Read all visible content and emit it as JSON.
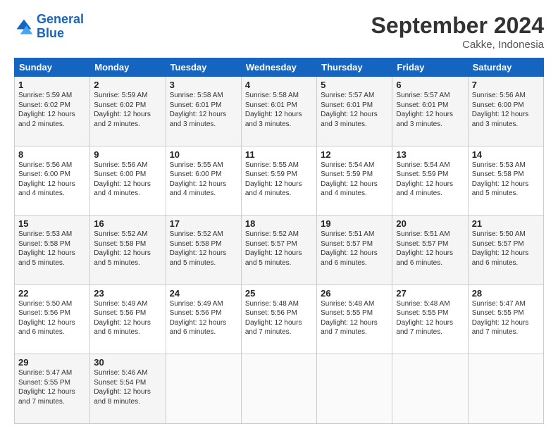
{
  "logo": {
    "line1": "General",
    "line2": "Blue"
  },
  "header": {
    "month": "September 2024",
    "location": "Cakke, Indonesia"
  },
  "weekdays": [
    "Sunday",
    "Monday",
    "Tuesday",
    "Wednesday",
    "Thursday",
    "Friday",
    "Saturday"
  ],
  "weeks": [
    [
      {
        "day": "1",
        "info": "Sunrise: 5:59 AM\nSunset: 6:02 PM\nDaylight: 12 hours\nand 2 minutes."
      },
      {
        "day": "2",
        "info": "Sunrise: 5:59 AM\nSunset: 6:02 PM\nDaylight: 12 hours\nand 2 minutes."
      },
      {
        "day": "3",
        "info": "Sunrise: 5:58 AM\nSunset: 6:01 PM\nDaylight: 12 hours\nand 3 minutes."
      },
      {
        "day": "4",
        "info": "Sunrise: 5:58 AM\nSunset: 6:01 PM\nDaylight: 12 hours\nand 3 minutes."
      },
      {
        "day": "5",
        "info": "Sunrise: 5:57 AM\nSunset: 6:01 PM\nDaylight: 12 hours\nand 3 minutes."
      },
      {
        "day": "6",
        "info": "Sunrise: 5:57 AM\nSunset: 6:01 PM\nDaylight: 12 hours\nand 3 minutes."
      },
      {
        "day": "7",
        "info": "Sunrise: 5:56 AM\nSunset: 6:00 PM\nDaylight: 12 hours\nand 3 minutes."
      }
    ],
    [
      {
        "day": "8",
        "info": "Sunrise: 5:56 AM\nSunset: 6:00 PM\nDaylight: 12 hours\nand 4 minutes."
      },
      {
        "day": "9",
        "info": "Sunrise: 5:56 AM\nSunset: 6:00 PM\nDaylight: 12 hours\nand 4 minutes."
      },
      {
        "day": "10",
        "info": "Sunrise: 5:55 AM\nSunset: 6:00 PM\nDaylight: 12 hours\nand 4 minutes."
      },
      {
        "day": "11",
        "info": "Sunrise: 5:55 AM\nSunset: 5:59 PM\nDaylight: 12 hours\nand 4 minutes."
      },
      {
        "day": "12",
        "info": "Sunrise: 5:54 AM\nSunset: 5:59 PM\nDaylight: 12 hours\nand 4 minutes."
      },
      {
        "day": "13",
        "info": "Sunrise: 5:54 AM\nSunset: 5:59 PM\nDaylight: 12 hours\nand 4 minutes."
      },
      {
        "day": "14",
        "info": "Sunrise: 5:53 AM\nSunset: 5:58 PM\nDaylight: 12 hours\nand 5 minutes."
      }
    ],
    [
      {
        "day": "15",
        "info": "Sunrise: 5:53 AM\nSunset: 5:58 PM\nDaylight: 12 hours\nand 5 minutes."
      },
      {
        "day": "16",
        "info": "Sunrise: 5:52 AM\nSunset: 5:58 PM\nDaylight: 12 hours\nand 5 minutes."
      },
      {
        "day": "17",
        "info": "Sunrise: 5:52 AM\nSunset: 5:58 PM\nDaylight: 12 hours\nand 5 minutes."
      },
      {
        "day": "18",
        "info": "Sunrise: 5:52 AM\nSunset: 5:57 PM\nDaylight: 12 hours\nand 5 minutes."
      },
      {
        "day": "19",
        "info": "Sunrise: 5:51 AM\nSunset: 5:57 PM\nDaylight: 12 hours\nand 6 minutes."
      },
      {
        "day": "20",
        "info": "Sunrise: 5:51 AM\nSunset: 5:57 PM\nDaylight: 12 hours\nand 6 minutes."
      },
      {
        "day": "21",
        "info": "Sunrise: 5:50 AM\nSunset: 5:57 PM\nDaylight: 12 hours\nand 6 minutes."
      }
    ],
    [
      {
        "day": "22",
        "info": "Sunrise: 5:50 AM\nSunset: 5:56 PM\nDaylight: 12 hours\nand 6 minutes."
      },
      {
        "day": "23",
        "info": "Sunrise: 5:49 AM\nSunset: 5:56 PM\nDaylight: 12 hours\nand 6 minutes."
      },
      {
        "day": "24",
        "info": "Sunrise: 5:49 AM\nSunset: 5:56 PM\nDaylight: 12 hours\nand 6 minutes."
      },
      {
        "day": "25",
        "info": "Sunrise: 5:48 AM\nSunset: 5:56 PM\nDaylight: 12 hours\nand 7 minutes."
      },
      {
        "day": "26",
        "info": "Sunrise: 5:48 AM\nSunset: 5:55 PM\nDaylight: 12 hours\nand 7 minutes."
      },
      {
        "day": "27",
        "info": "Sunrise: 5:48 AM\nSunset: 5:55 PM\nDaylight: 12 hours\nand 7 minutes."
      },
      {
        "day": "28",
        "info": "Sunrise: 5:47 AM\nSunset: 5:55 PM\nDaylight: 12 hours\nand 7 minutes."
      }
    ],
    [
      {
        "day": "29",
        "info": "Sunrise: 5:47 AM\nSunset: 5:55 PM\nDaylight: 12 hours\nand 7 minutes."
      },
      {
        "day": "30",
        "info": "Sunrise: 5:46 AM\nSunset: 5:54 PM\nDaylight: 12 hours\nand 8 minutes."
      },
      {
        "day": "",
        "info": ""
      },
      {
        "day": "",
        "info": ""
      },
      {
        "day": "",
        "info": ""
      },
      {
        "day": "",
        "info": ""
      },
      {
        "day": "",
        "info": ""
      }
    ]
  ]
}
